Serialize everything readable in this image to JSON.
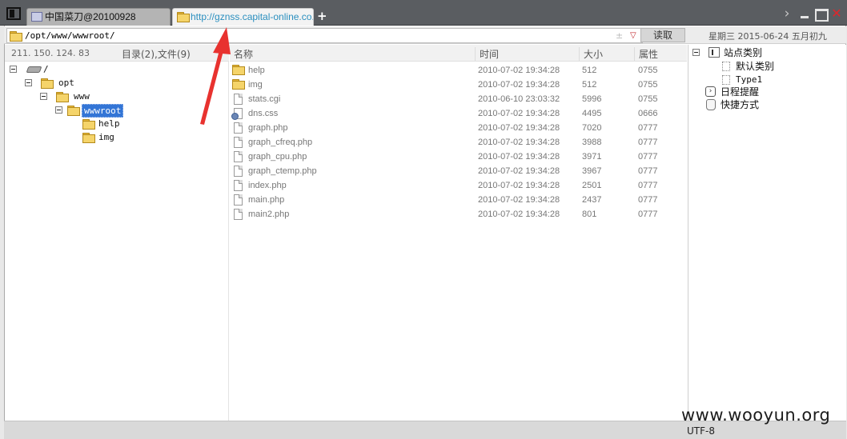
{
  "tabs": [
    {
      "label": "中国菜刀@20100928",
      "active": false
    },
    {
      "label": "http://gznss.capital-online.co...",
      "active": true
    }
  ],
  "new_tab_label": "+",
  "window_controls": {
    "chevron": "›",
    "close": "✕"
  },
  "address": {
    "path": "/opt/www/wwwroot/",
    "history_glyph": "±",
    "dropdown_glyph": "▽",
    "read_button": "读取",
    "date": "星期三  2015-06-24 五月初九"
  },
  "left_header": {
    "ip": "211. 150. 124. 83",
    "summary": "目录(2),文件(9)"
  },
  "tree": [
    {
      "label": "/",
      "depth": 0,
      "icon": "drive-icon"
    },
    {
      "label": "opt",
      "depth": 1,
      "icon": "folder-icon"
    },
    {
      "label": "www",
      "depth": 2,
      "icon": "folder-icon"
    },
    {
      "label": "wwwroot",
      "depth": 3,
      "icon": "folder-open-icon",
      "selected": true
    },
    {
      "label": "help",
      "depth": 4,
      "icon": "folder-icon"
    },
    {
      "label": "img",
      "depth": 4,
      "icon": "folder-icon"
    }
  ],
  "columns": {
    "name": "名称",
    "time": "时间",
    "size": "大小",
    "attr": "属性"
  },
  "files": [
    {
      "name": "help",
      "time": "2010-07-02 19:34:28",
      "size": "512",
      "attr": "0755",
      "icon": "folder-icon"
    },
    {
      "name": "img",
      "time": "2010-07-02 19:34:28",
      "size": "512",
      "attr": "0755",
      "icon": "folder-icon"
    },
    {
      "name": "stats.cgi",
      "time": "2010-06-10 23:03:32",
      "size": "5996",
      "attr": "0755",
      "icon": "file-icon"
    },
    {
      "name": "dns.css",
      "time": "2010-07-02 19:34:28",
      "size": "4495",
      "attr": "0666",
      "icon": "css-file-icon"
    },
    {
      "name": "graph.php",
      "time": "2010-07-02 19:34:28",
      "size": "7020",
      "attr": "0777",
      "icon": "file-icon"
    },
    {
      "name": "graph_cfreq.php",
      "time": "2010-07-02 19:34:28",
      "size": "3988",
      "attr": "0777",
      "icon": "file-icon"
    },
    {
      "name": "graph_cpu.php",
      "time": "2010-07-02 19:34:28",
      "size": "3971",
      "attr": "0777",
      "icon": "file-icon"
    },
    {
      "name": "graph_ctemp.php",
      "time": "2010-07-02 19:34:28",
      "size": "3967",
      "attr": "0777",
      "icon": "file-icon"
    },
    {
      "name": "index.php",
      "time": "2010-07-02 19:34:28",
      "size": "2501",
      "attr": "0777",
      "icon": "file-icon"
    },
    {
      "name": "main.php",
      "time": "2010-07-02 19:34:28",
      "size": "2437",
      "attr": "0777",
      "icon": "file-icon"
    },
    {
      "name": "main2.php",
      "time": "2010-07-02 19:34:28",
      "size": "801",
      "attr": "0777",
      "icon": "file-icon"
    }
  ],
  "right_panel": {
    "site_category": "站点类别",
    "items": [
      "默认类别",
      "Type1"
    ],
    "schedule": "日程提醒",
    "shortcuts": "快捷方式"
  },
  "status": {
    "encoding": "UTF-8",
    "watermark": "www.wooyun.org"
  },
  "colors": {
    "accent": "#3375d6",
    "annotation_arrow": "#e8322f",
    "tab_active_text": "#2a8fbf",
    "close": "#e0262b"
  }
}
